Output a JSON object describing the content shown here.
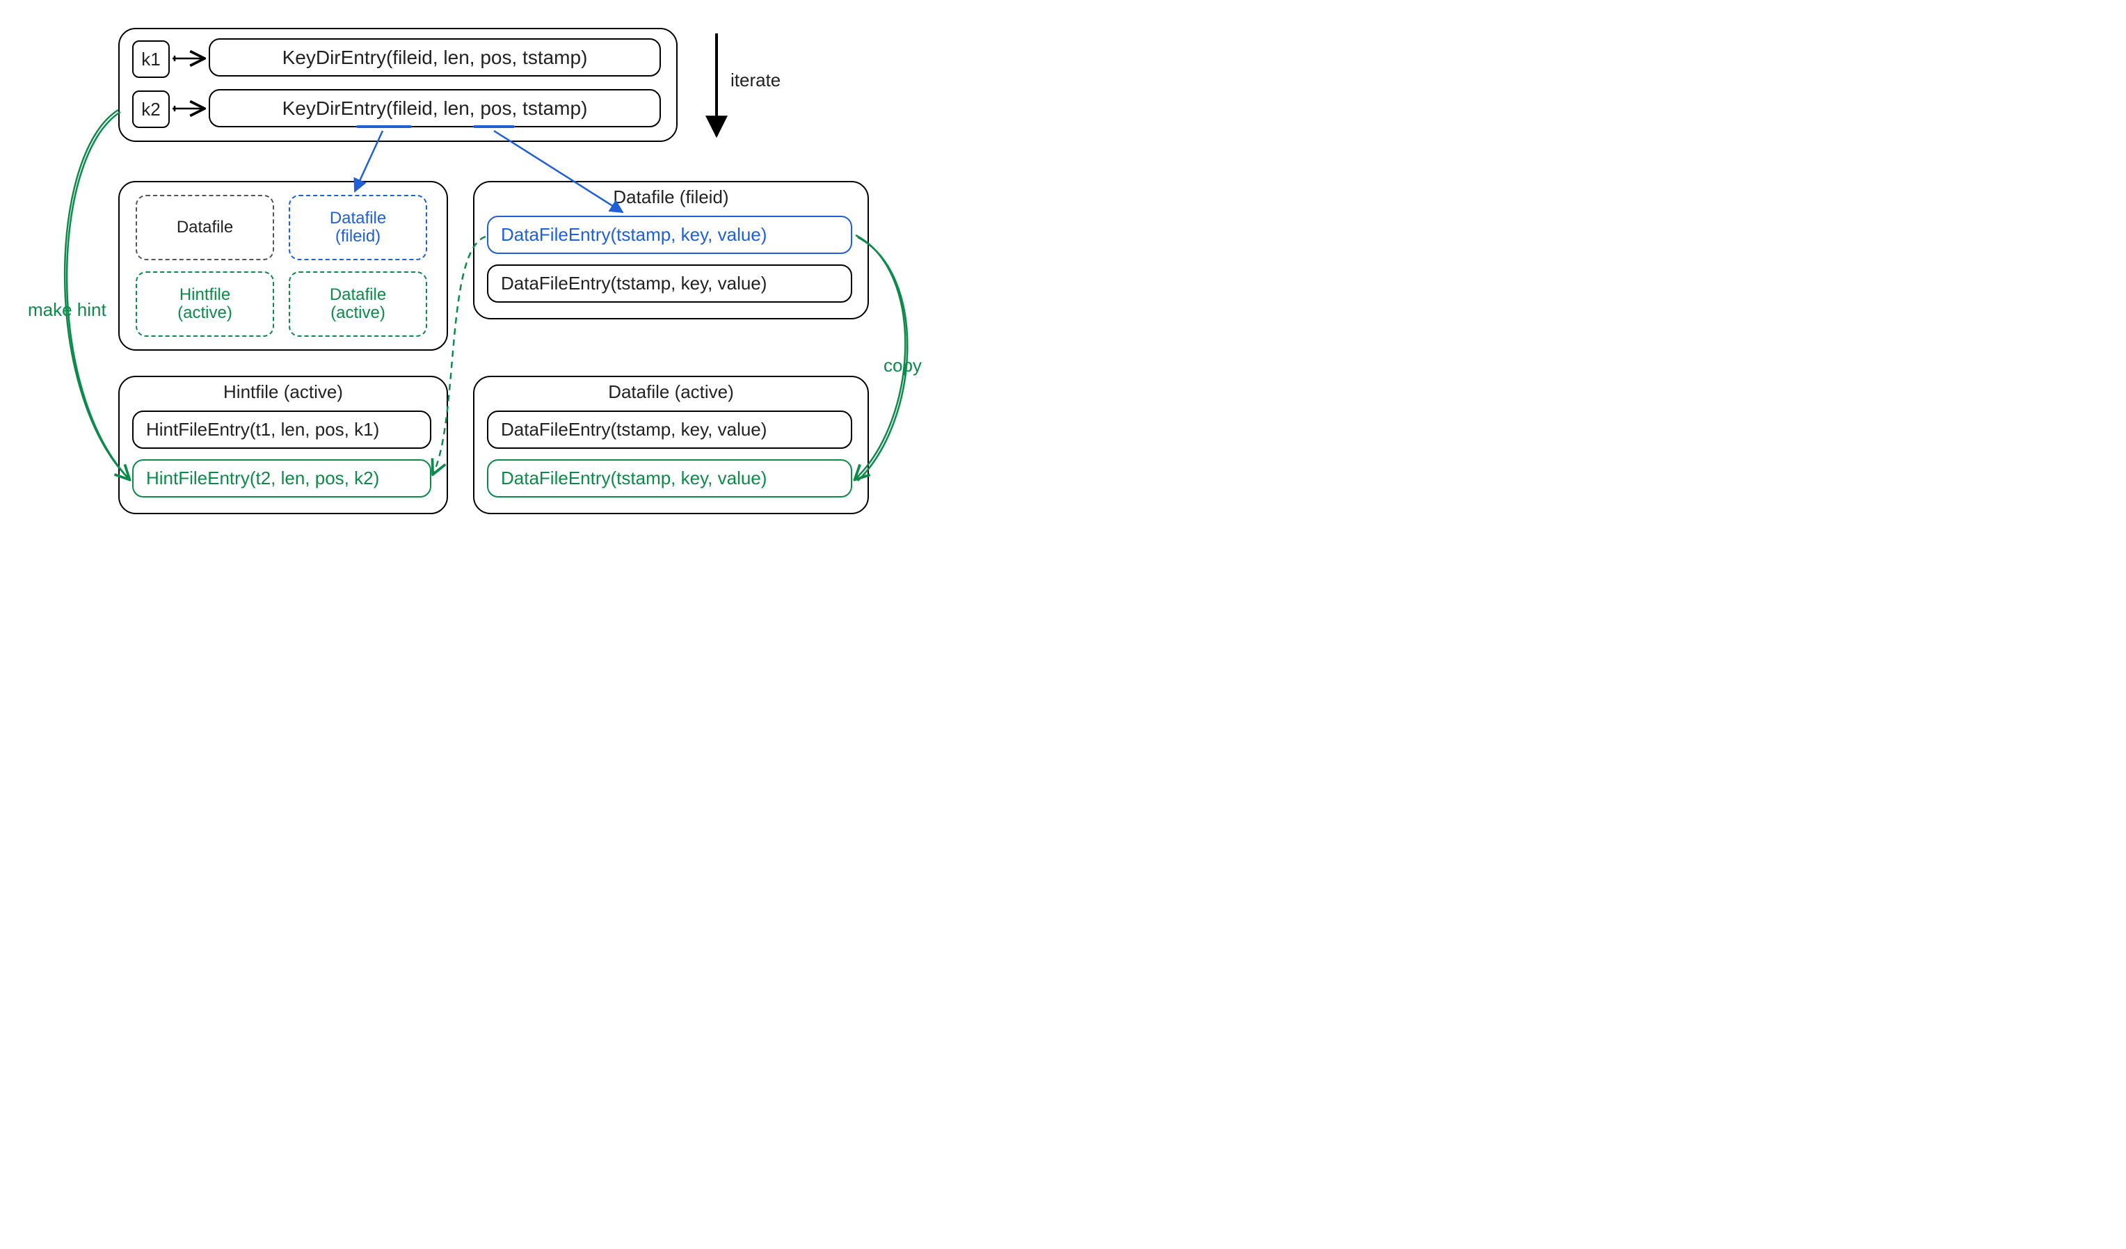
{
  "keydir": {
    "keys": [
      "k1",
      "k2"
    ],
    "entry": "KeyDirEntry(fileid, len, pos, tstamp)"
  },
  "iterate_label": "iterate",
  "files_grid": {
    "datafile": "Datafile",
    "datafile_fileid": "Datafile\n(fileid)",
    "hintfile_active": "Hintfile\n(active)",
    "datafile_active": "Datafile\n(active)"
  },
  "datafile_fileid": {
    "title": "Datafile (fileid)",
    "entry1": "DataFileEntry(tstamp, key, value)",
    "entry2": "DataFileEntry(tstamp, key, value)"
  },
  "hintfile_active": {
    "title": "Hintfile (active)",
    "entry1": "HintFileEntry(t1, len, pos, k1)",
    "entry2": "HintFileEntry(t2, len, pos, k2)"
  },
  "datafile_active": {
    "title": "Datafile (active)",
    "entry1": "DataFileEntry(tstamp, key, value)",
    "entry2": "DataFileEntry(tstamp, key, value)"
  },
  "make_hint_label": "make hint",
  "copy_label": "copy"
}
